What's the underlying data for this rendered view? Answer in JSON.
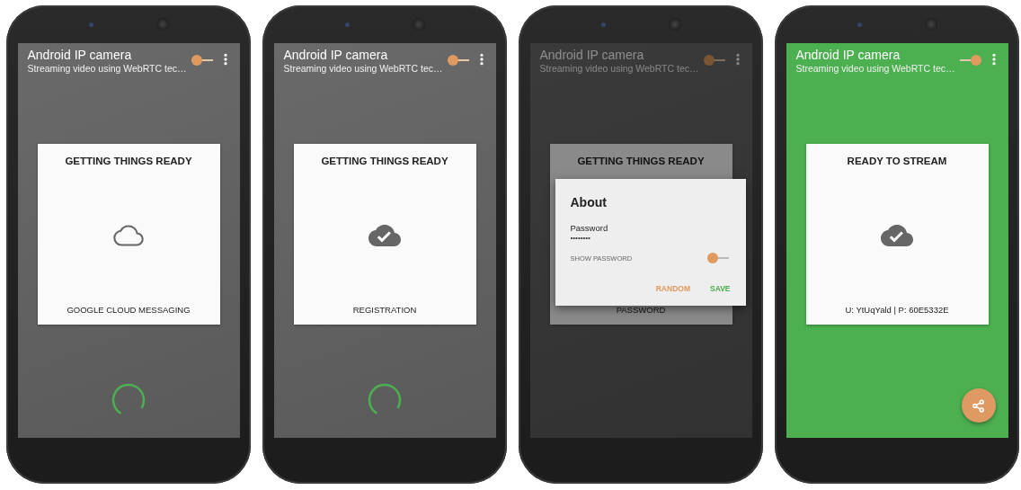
{
  "phones": [
    {
      "ready": false,
      "toolbar": {
        "title": "Android IP camera",
        "subtitle": "Streaming video using WebRTC tec…",
        "switch_on": false
      },
      "card": {
        "title": "GETTING THINGS READY",
        "kind": "pending",
        "caption": "GOOGLE CLOUD MESSAGING"
      },
      "spinner": true
    },
    {
      "ready": false,
      "toolbar": {
        "title": "Android IP camera",
        "subtitle": "Streaming video using WebRTC tec…",
        "switch_on": false
      },
      "card": {
        "title": "GETTING THINGS READY",
        "kind": "done",
        "caption": "REGISTRATION"
      },
      "spinner": true
    },
    {
      "ready": false,
      "toolbar": {
        "title": "Android IP camera",
        "subtitle": "Streaming video using WebRTC tec…",
        "switch_on": false
      },
      "card": {
        "title": "GETTING THINGS READY",
        "caption": "PASSWORD"
      },
      "dialog": {
        "title": "About",
        "field_label": "Password",
        "field_value": "••••••••",
        "toggle_label": "SHOW PASSWORD",
        "toggle_on": false,
        "buttons": [
          {
            "label": "RANDOM",
            "kind": "neutral"
          },
          {
            "label": "SAVE",
            "kind": "confirm"
          }
        ]
      }
    },
    {
      "ready": true,
      "toolbar": {
        "title": "Android IP camera",
        "subtitle": "Streaming video using WebRTC tec…",
        "switch_on": true
      },
      "card": {
        "title": "READY TO STREAM",
        "kind": "done",
        "caption": "U: YtUqYald | P: 60E5332E"
      },
      "fab": {
        "kind": "share"
      }
    }
  ]
}
